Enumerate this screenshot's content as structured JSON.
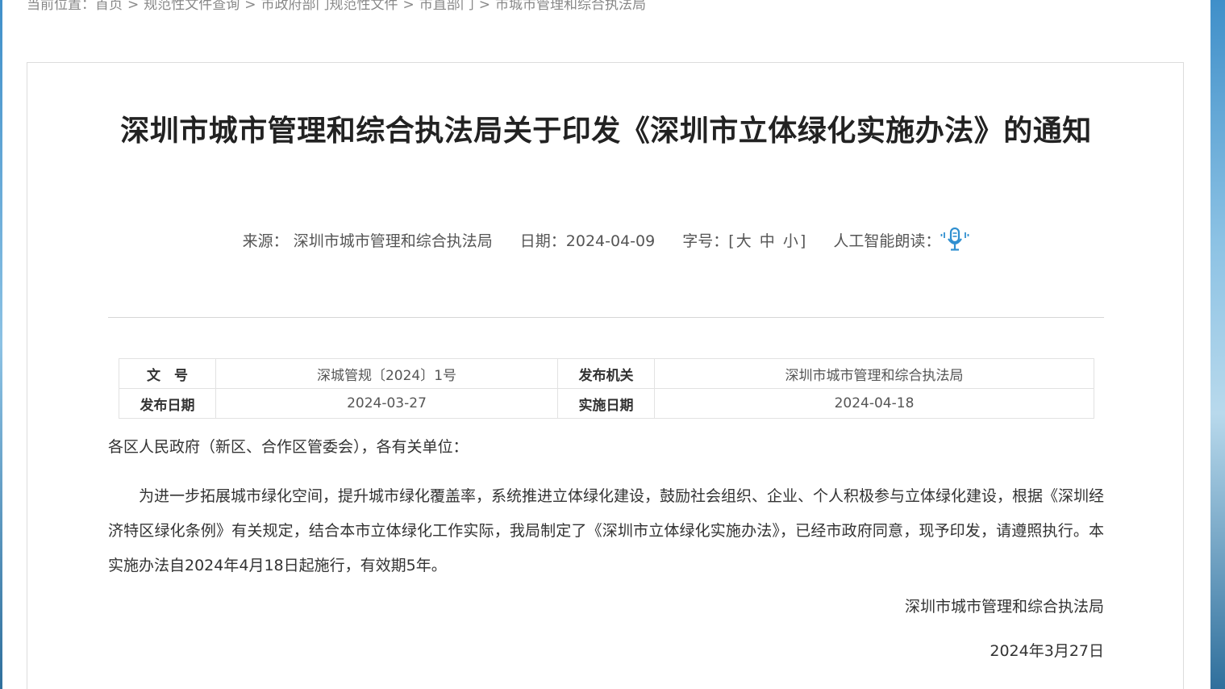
{
  "breadcrumb": {
    "prefix": "当前位置：",
    "items": [
      "首页",
      "规范性文件查询",
      "市政府部门规范性文件",
      "市直部门",
      "市城市管理和综合执法局"
    ],
    "separator": ">"
  },
  "article": {
    "title": "深圳市城市管理和综合执法局关于印发《深圳市立体绿化实施办法》的通知",
    "meta": {
      "source_label": "来源：",
      "source_value": "深圳市城市管理和综合执法局",
      "date_label": "日期：",
      "date_value": "2024-04-09",
      "font_label": "字号：",
      "font_open": "[",
      "font_large": "大",
      "font_medium": "中",
      "font_small": "小",
      "font_close": "]",
      "ai_read_label": "人工智能朗读：",
      "ai_read_icon": "microphone-icon"
    },
    "info_table": {
      "doc_no_label": "文　号",
      "doc_no_value": "深城管规〔2024〕1号",
      "issuer_label": "发布机关",
      "issuer_value": "深圳市城市管理和综合执法局",
      "publish_date_label": "发布日期",
      "publish_date_value": "2024-03-27",
      "effective_date_label": "实施日期",
      "effective_date_value": "2024-04-18"
    },
    "salutation": "各区人民政府（新区、合作区管委会），各有关单位：",
    "paragraph": "为进一步拓展城市绿化空间，提升城市绿化覆盖率，系统推进立体绿化建设，鼓励社会组织、企业、个人积极参与立体绿化建设，根据《深圳经济特区绿化条例》有关规定，结合本市立体绿化工作实际，我局制定了《深圳市立体绿化实施办法》，已经市政府同意，现予印发，请遵照执行。本实施办法自2024年4月18日起施行，有效期5年。",
    "signature": "深圳市城市管理和综合执法局",
    "signature_date": "2024年3月27日"
  },
  "colors": {
    "accent": "#2f8fd0",
    "text": "#333333",
    "muted": "#888888"
  }
}
